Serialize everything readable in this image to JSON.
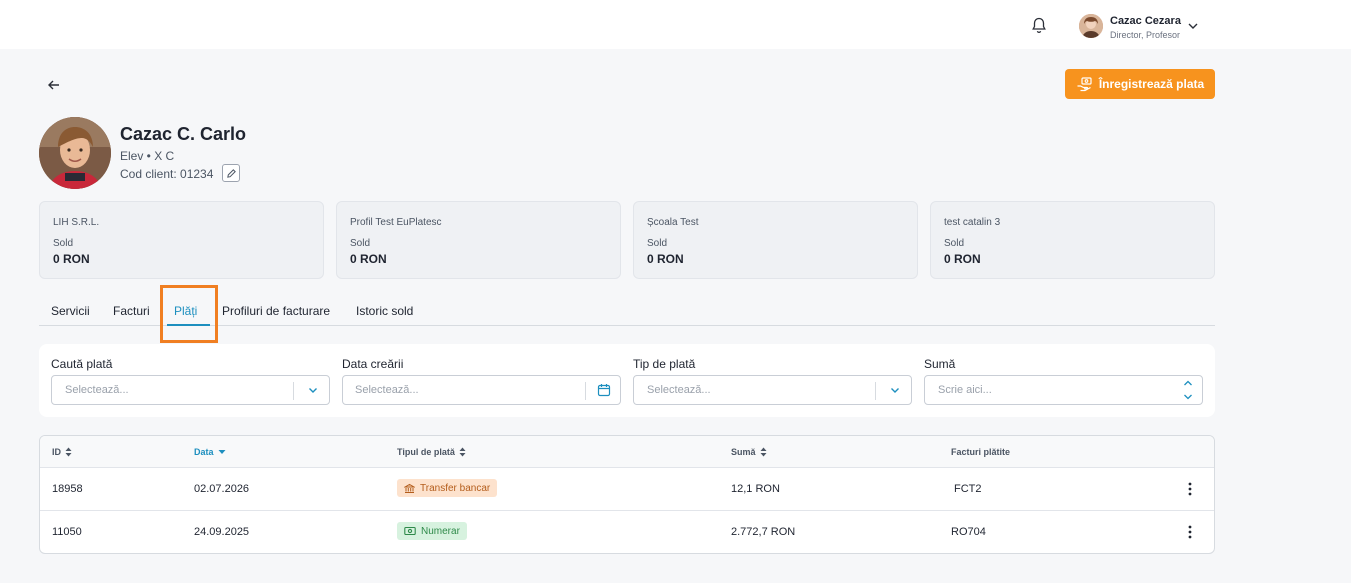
{
  "header": {
    "user_name": "Cazac Cezara",
    "user_role": "Director, Profesor",
    "icons": [
      "bell-icon",
      "chevron-down-icon"
    ]
  },
  "actions": {
    "register_payment": "Înregistrează plata"
  },
  "student": {
    "name": "Cazac C. Carlo",
    "meta": "Elev • X C",
    "client_code": "Cod client: 01234"
  },
  "balances": [
    {
      "name": "LIH S.R.L.",
      "label": "Sold",
      "value": "0 RON"
    },
    {
      "name": "Profil Test EuPlatesc",
      "label": "Sold",
      "value": "0 RON"
    },
    {
      "name": "Școala Test",
      "label": "Sold",
      "value": "0 RON"
    },
    {
      "name": "test catalin 3",
      "label": "Sold",
      "value": "0 RON"
    }
  ],
  "tabs": [
    {
      "label": "Servicii"
    },
    {
      "label": "Facturi"
    },
    {
      "label": "Plăți"
    },
    {
      "label": "Profiluri de facturare"
    },
    {
      "label": "Istoric sold"
    }
  ],
  "active_tab": "Plăți",
  "filters": [
    {
      "label": "Caută plată",
      "placeholder": "Selectează..."
    },
    {
      "label": "Data creării",
      "placeholder": "Selectează..."
    },
    {
      "label": "Tip de plată",
      "placeholder": "Selectează..."
    },
    {
      "label": "Sumă",
      "placeholder": "Scrie aici..."
    }
  ],
  "table": {
    "columns": [
      "ID",
      "Data",
      "Tipul de plată",
      "Sumă",
      "Facturi plătite"
    ],
    "rows": [
      {
        "id": "18958",
        "date": "02.07.2026",
        "type": "Transfer bancar",
        "amount": "12,1 RON",
        "invoices": "FCT2"
      },
      {
        "id": "11050",
        "date": "24.09.2025",
        "type": "Numerar",
        "amount": "2.772,7 RON",
        "invoices": "RO704"
      }
    ]
  },
  "colors": {
    "accent": "#1d8fbf",
    "primary_button": "#f7931e",
    "highlight": "#f07f22"
  }
}
